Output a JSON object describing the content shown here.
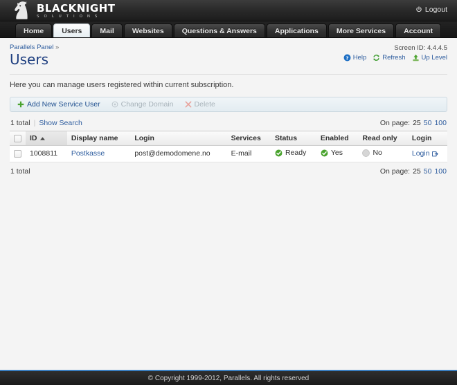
{
  "header": {
    "brand_name": "BLACKNIGHT",
    "brand_sub": "S O L U T I O N S",
    "logo_icon": "knight-chess-piece-logo",
    "logout_label": "Logout",
    "logout_icon": "power-icon"
  },
  "nav": {
    "tabs": [
      {
        "label": "Home",
        "active": false
      },
      {
        "label": "Users",
        "active": true
      },
      {
        "label": "Mail",
        "active": false
      },
      {
        "label": "Websites",
        "active": false
      },
      {
        "label": "Questions & Answers",
        "active": false
      },
      {
        "label": "Applications",
        "active": false
      },
      {
        "label": "More Services",
        "active": false
      },
      {
        "label": "Account",
        "active": false
      }
    ]
  },
  "page": {
    "breadcrumb_label": "Parallels Panel",
    "breadcrumb_separator": "»",
    "title": "Users",
    "description": "Here you can manage users registered within current subscription.",
    "screen_id_label": "Screen ID:",
    "screen_id_value": "4.4.4.5",
    "tools": [
      {
        "label": "Help",
        "icon": "help-question-icon"
      },
      {
        "label": "Refresh",
        "icon": "refresh-icon"
      },
      {
        "label": "Up Level",
        "icon": "up-level-arrow-icon"
      }
    ]
  },
  "toolbar": {
    "add_label": "Add New Service User",
    "add_icon": "plus-icon",
    "change_domain_label": "Change Domain",
    "change_domain_icon": "change-domain-icon",
    "delete_label": "Delete",
    "delete_icon": "delete-x-icon"
  },
  "list": {
    "total_label": "1 total",
    "show_search_label": "Show Search",
    "separator": "|",
    "on_page_label": "On page:",
    "page_sizes": [
      {
        "value": "25",
        "selected": true
      },
      {
        "value": "50",
        "selected": false
      },
      {
        "value": "100",
        "selected": false
      }
    ],
    "columns": [
      {
        "label": "ID",
        "sorted": true,
        "sort_icon": "sort-ascending-caret"
      },
      {
        "label": "Display name",
        "sorted": false
      },
      {
        "label": "Login",
        "sorted": false
      },
      {
        "label": "Services",
        "sorted": false
      },
      {
        "label": "Status",
        "sorted": false
      },
      {
        "label": "Enabled",
        "sorted": false
      },
      {
        "label": "Read only",
        "sorted": false
      },
      {
        "label": "Login",
        "sorted": false
      }
    ],
    "rows": [
      {
        "id": "1008811",
        "display_name": "Postkasse",
        "login": "post@demodomene.no",
        "services": "E-mail",
        "status": "Ready",
        "status_icon": "green-check-icon",
        "enabled": "Yes",
        "enabled_icon": "green-check-icon",
        "read_only": "No",
        "read_only_icon": "gray-circle-icon",
        "login_action": "Login",
        "login_action_icon": "external-link-icon"
      }
    ]
  },
  "footer": {
    "copyright": "© Copyright 1999-2012, Parallels. All rights reserved"
  },
  "colors": {
    "link": "#2d5c9e",
    "title": "#1f3f80",
    "accent_footer_rule": "#3a7fc1",
    "status_green": "#4aa32e",
    "delete_red": "#d4453a",
    "header_dark": "#2b2b2b"
  }
}
